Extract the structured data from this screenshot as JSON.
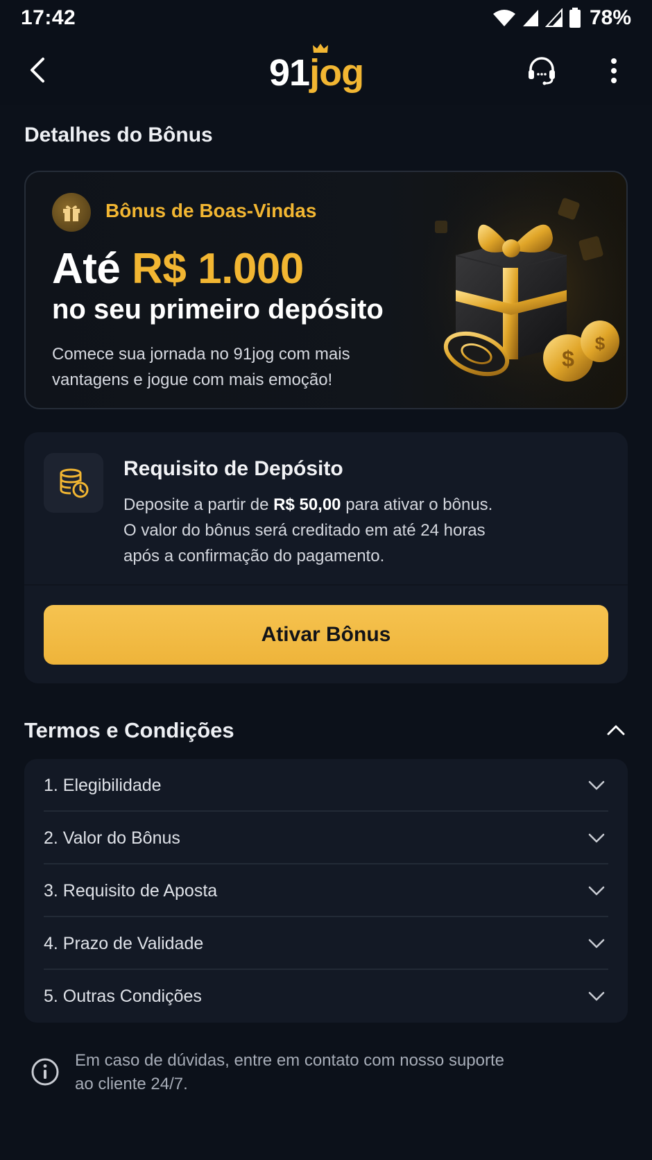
{
  "status_bar": {
    "time": "17:42",
    "battery": "78%"
  },
  "app_bar": {
    "logo_number": "91",
    "logo_word": "jog"
  },
  "page_title": "Detalhes do Bônus",
  "hero": {
    "badge": "Bônus de Boas-Vindas",
    "amount_prefix": "Até ",
    "amount_value": "R$ 1.000",
    "subtitle": "no seu primeiro depósito",
    "description": "Comece sua jornada no 91jog com mais vantagens e jogue com mais emoção!"
  },
  "deposit": {
    "title": "Requisito de Depósito",
    "text_before": "Deposite a partir de ",
    "text_amount": "R$ 50,00",
    "text_after": " para ativar o bônus.",
    "text_line2": "O valor do bônus será creditado em até 24 horas após a confirmação do pagamento.",
    "button_label": "Ativar Bônus"
  },
  "terms": {
    "title": "Termos e Condições",
    "items": [
      {
        "label": "1. Elegibilidade"
      },
      {
        "label": "2. Valor do Bônus"
      },
      {
        "label": "3. Requisito de Aposta"
      },
      {
        "label": "4. Prazo de Validade"
      },
      {
        "label": "5. Outras Condições"
      }
    ]
  },
  "info": {
    "text": "Em caso de dúvidas, entre em contato com nosso suporte ao cliente 24/7."
  },
  "colors": {
    "accent": "#f2b632",
    "background": "#0c111a",
    "card": "#131925"
  },
  "icons": [
    "back-icon",
    "crown-icon",
    "headset-icon",
    "more-vertical-icon",
    "gift-icon",
    "coin-stack-icon",
    "chevron-up-icon",
    "chevron-down-icon",
    "info-icon",
    "wifi-icon",
    "signal-icon",
    "battery-icon"
  ]
}
